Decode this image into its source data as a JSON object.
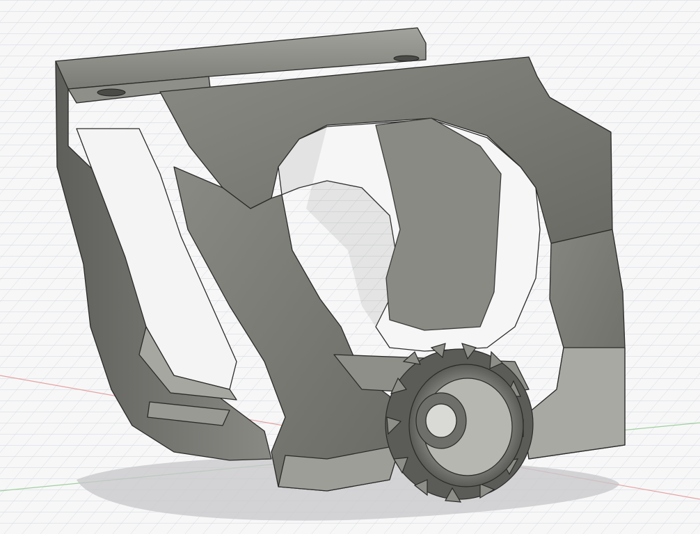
{
  "viewport": {
    "background": "#f7f7f8",
    "grid_color": "#c9cdd3",
    "x_axis_color": "#e0a0a0",
    "y_axis_color": "#a0d0a0"
  },
  "model": {
    "body_color": "#757570",
    "edge_color": "#2a2a28",
    "shadow_color": "#cfcfd1"
  }
}
